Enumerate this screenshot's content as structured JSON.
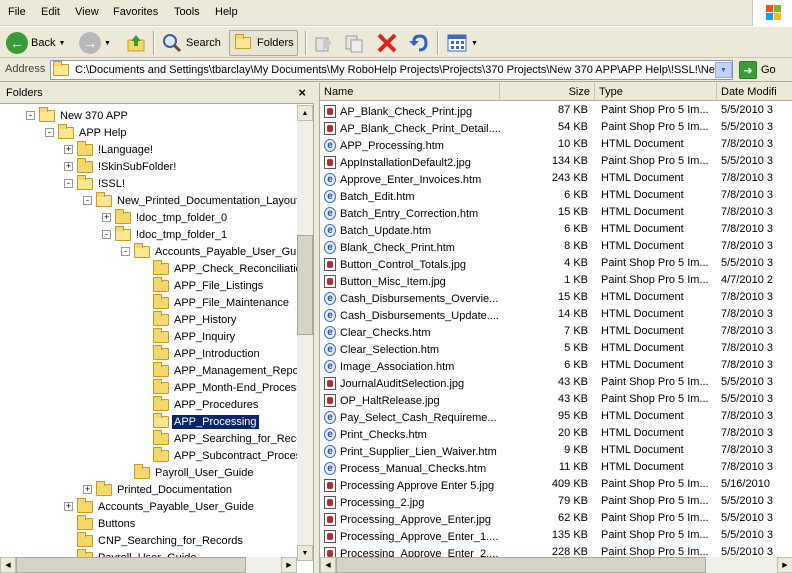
{
  "menu": [
    "File",
    "Edit",
    "View",
    "Favorites",
    "Tools",
    "Help"
  ],
  "toolbar": {
    "back_label": "Back",
    "search_label": "Search",
    "folders_label": "Folders"
  },
  "address": {
    "label": "Address",
    "value": "C:\\Documents and Settings\\tbarclay\\My Documents\\My RoboHelp Projects\\Projects\\370 Projects\\New 370 APP\\APP Help\\!SSL!\\New_P",
    "go_label": "Go"
  },
  "folders_pane": {
    "title": "Folders",
    "close": "×",
    "tree": [
      {
        "label": "New 370 APP",
        "level": 0,
        "expander": "-"
      },
      {
        "label": "APP Help",
        "level": 1,
        "expander": "-"
      },
      {
        "label": "!Language!",
        "level": 2,
        "expander": "+"
      },
      {
        "label": "!SkinSubFolder!",
        "level": 2,
        "expander": "+"
      },
      {
        "label": "!SSL!",
        "level": 2,
        "expander": "-"
      },
      {
        "label": "New_Printed_Documentation_Layout",
        "level": 3,
        "expander": "-"
      },
      {
        "label": "!doc_tmp_folder_0",
        "level": 4,
        "expander": "+"
      },
      {
        "label": "!doc_tmp_folder_1",
        "level": 4,
        "expander": "-"
      },
      {
        "label": "Accounts_Payable_User_Guid",
        "level": 5,
        "expander": "-"
      },
      {
        "label": "APP_Check_Reconciliation",
        "level": 6,
        "expander": ""
      },
      {
        "label": "APP_File_Listings",
        "level": 6,
        "expander": ""
      },
      {
        "label": "APP_File_Maintenance",
        "level": 6,
        "expander": ""
      },
      {
        "label": "APP_History",
        "level": 6,
        "expander": ""
      },
      {
        "label": "APP_Inquiry",
        "level": 6,
        "expander": ""
      },
      {
        "label": "APP_Introduction",
        "level": 6,
        "expander": ""
      },
      {
        "label": "APP_Management_Repor",
        "level": 6,
        "expander": ""
      },
      {
        "label": "APP_Month-End_Processi",
        "level": 6,
        "expander": ""
      },
      {
        "label": "APP_Procedures",
        "level": 6,
        "expander": ""
      },
      {
        "label": "APP_Processing",
        "level": 6,
        "expander": "",
        "selected": true
      },
      {
        "label": "APP_Searching_for_Reco",
        "level": 6,
        "expander": ""
      },
      {
        "label": "APP_Subcontract_Proces",
        "level": 6,
        "expander": ""
      },
      {
        "label": "Payroll_User_Guide",
        "level": 5,
        "expander": ""
      },
      {
        "label": "Printed_Documentation",
        "level": 3,
        "expander": "+"
      },
      {
        "label": "Accounts_Payable_User_Guide",
        "level": 2,
        "expander": "+"
      },
      {
        "label": "Buttons",
        "level": 2,
        "expander": ""
      },
      {
        "label": "CNP_Searching_for_Records",
        "level": 2,
        "expander": ""
      },
      {
        "label": "Payroll_User_Guide",
        "level": 2,
        "expander": ""
      }
    ]
  },
  "file_list": {
    "columns": {
      "name": "Name",
      "size": "Size",
      "type": "Type",
      "date": "Date Modifi"
    },
    "rows": [
      {
        "name": "AP_Blank_Check_Print.jpg",
        "size": "87 KB",
        "type": "Paint Shop Pro 5 Im...",
        "date": "5/5/2010 3",
        "icon": "jpg"
      },
      {
        "name": "AP_Blank_Check_Print_Detail....",
        "size": "54 KB",
        "type": "Paint Shop Pro 5 Im...",
        "date": "5/5/2010 3",
        "icon": "jpg"
      },
      {
        "name": "APP_Processing.htm",
        "size": "10 KB",
        "type": "HTML Document",
        "date": "7/8/2010 3",
        "icon": "htm"
      },
      {
        "name": "AppInstallationDefault2.jpg",
        "size": "134 KB",
        "type": "Paint Shop Pro 5 Im...",
        "date": "5/5/2010 3",
        "icon": "jpg"
      },
      {
        "name": "Approve_Enter_Invoices.htm",
        "size": "243 KB",
        "type": "HTML Document",
        "date": "7/8/2010 3",
        "icon": "htm"
      },
      {
        "name": "Batch_Edit.htm",
        "size": "6 KB",
        "type": "HTML Document",
        "date": "7/8/2010 3",
        "icon": "htm"
      },
      {
        "name": "Batch_Entry_Correction.htm",
        "size": "15 KB",
        "type": "HTML Document",
        "date": "7/8/2010 3",
        "icon": "htm"
      },
      {
        "name": "Batch_Update.htm",
        "size": "6 KB",
        "type": "HTML Document",
        "date": "7/8/2010 3",
        "icon": "htm"
      },
      {
        "name": "Blank_Check_Print.htm",
        "size": "8 KB",
        "type": "HTML Document",
        "date": "7/8/2010 3",
        "icon": "htm"
      },
      {
        "name": "Button_Control_Totals.jpg",
        "size": "4 KB",
        "type": "Paint Shop Pro 5 Im...",
        "date": "5/5/2010 3",
        "icon": "jpg"
      },
      {
        "name": "Button_Misc_Item.jpg",
        "size": "1 KB",
        "type": "Paint Shop Pro 5 Im...",
        "date": "4/7/2010 2",
        "icon": "jpg"
      },
      {
        "name": "Cash_Disbursements_Overvie...",
        "size": "15 KB",
        "type": "HTML Document",
        "date": "7/8/2010 3",
        "icon": "htm"
      },
      {
        "name": "Cash_Disbursements_Update....",
        "size": "14 KB",
        "type": "HTML Document",
        "date": "7/8/2010 3",
        "icon": "htm"
      },
      {
        "name": "Clear_Checks.htm",
        "size": "7 KB",
        "type": "HTML Document",
        "date": "7/8/2010 3",
        "icon": "htm"
      },
      {
        "name": "Clear_Selection.htm",
        "size": "5 KB",
        "type": "HTML Document",
        "date": "7/8/2010 3",
        "icon": "htm"
      },
      {
        "name": "Image_Association.htm",
        "size": "6 KB",
        "type": "HTML Document",
        "date": "7/8/2010 3",
        "icon": "htm"
      },
      {
        "name": "JournalAuditSelection.jpg",
        "size": "43 KB",
        "type": "Paint Shop Pro 5 Im...",
        "date": "5/5/2010 3",
        "icon": "jpg"
      },
      {
        "name": "OP_HaltRelease.jpg",
        "size": "43 KB",
        "type": "Paint Shop Pro 5 Im...",
        "date": "5/5/2010 3",
        "icon": "jpg"
      },
      {
        "name": "Pay_Select_Cash_Requireme...",
        "size": "95 KB",
        "type": "HTML Document",
        "date": "7/8/2010 3",
        "icon": "htm"
      },
      {
        "name": "Print_Checks.htm",
        "size": "20 KB",
        "type": "HTML Document",
        "date": "7/8/2010 3",
        "icon": "htm"
      },
      {
        "name": "Print_Supplier_Lien_Waiver.htm",
        "size": "9 KB",
        "type": "HTML Document",
        "date": "7/8/2010 3",
        "icon": "htm"
      },
      {
        "name": "Process_Manual_Checks.htm",
        "size": "11 KB",
        "type": "HTML Document",
        "date": "7/8/2010 3",
        "icon": "htm"
      },
      {
        "name": "Processing Approve Enter 5.jpg",
        "size": "409 KB",
        "type": "Paint Shop Pro 5 Im...",
        "date": "5/16/2010",
        "icon": "jpg"
      },
      {
        "name": "Processing_2.jpg",
        "size": "79 KB",
        "type": "Paint Shop Pro 5 Im...",
        "date": "5/5/2010 3",
        "icon": "jpg"
      },
      {
        "name": "Processing_Approve_Enter.jpg",
        "size": "62 KB",
        "type": "Paint Shop Pro 5 Im...",
        "date": "5/5/2010 3",
        "icon": "jpg"
      },
      {
        "name": "Processing_Approve_Enter_1....",
        "size": "135 KB",
        "type": "Paint Shop Pro 5 Im...",
        "date": "5/5/2010 3",
        "icon": "jpg"
      },
      {
        "name": "Processing_Approve_Enter_2....",
        "size": "228 KB",
        "type": "Paint Shop Pro 5 Im...",
        "date": "5/5/2010 3",
        "icon": "jpg"
      }
    ]
  }
}
